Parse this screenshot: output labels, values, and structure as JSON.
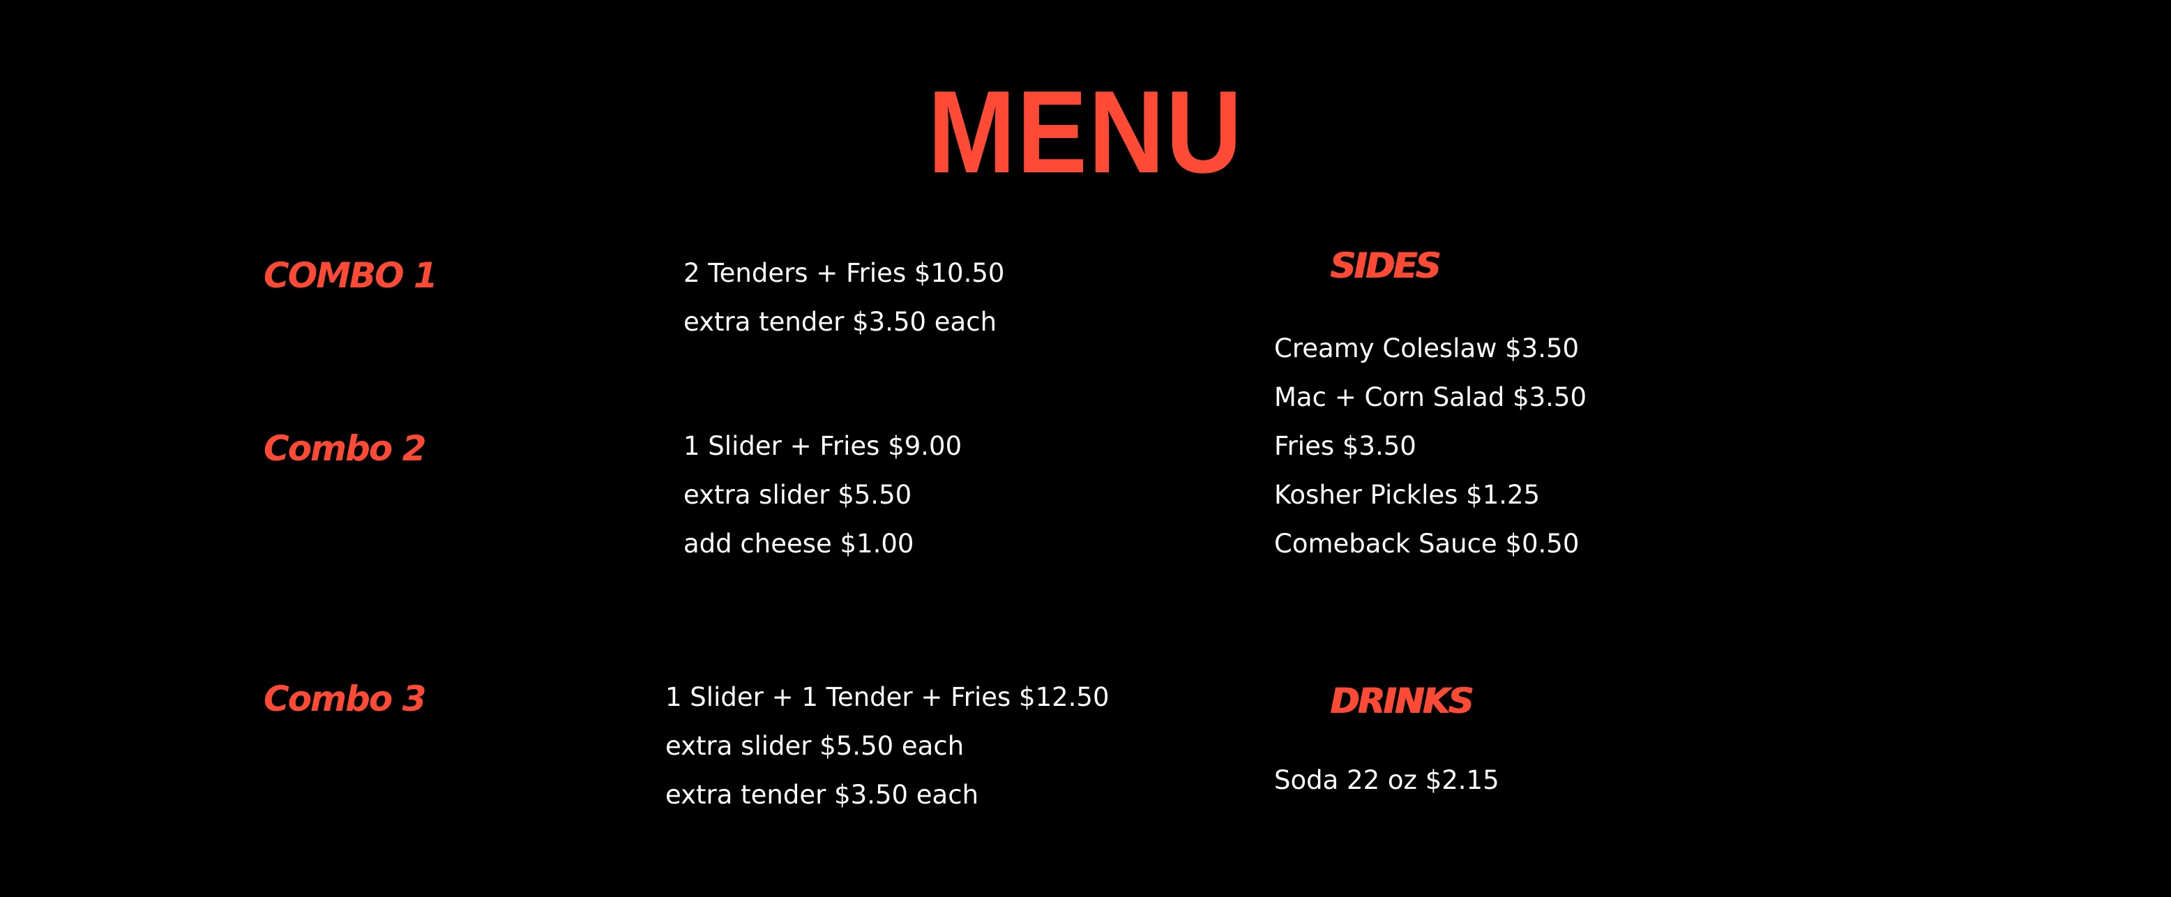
{
  "title": "MENU",
  "combos": [
    {
      "name": "COMBO 1",
      "items": [
        "2 Tenders + Fries $10.50",
        "extra tender $3.50 each"
      ]
    },
    {
      "name": "Combo 2",
      "items": [
        "1 Slider + Fries $9.00",
        "extra slider $5.50",
        "add cheese $1.00"
      ]
    },
    {
      "name": "Combo 3",
      "items": [
        "1 Slider + 1 Tender + Fries $12.50",
        "extra slider $5.50 each",
        "extra tender $3.50 each"
      ]
    }
  ],
  "sides": {
    "heading": "SIDES",
    "items": [
      "Creamy Coleslaw $3.50",
      "Mac + Corn Salad $3.50",
      "Fries $3.50",
      "Kosher Pickles $1.25",
      "Comeback Sauce $0.50"
    ]
  },
  "drinks": {
    "heading": "DRINKS",
    "items": [
      "Soda 22 oz $2.15"
    ]
  },
  "colors": {
    "background": "#000000",
    "accent": "#ff4a36",
    "text": "#ffffff"
  }
}
